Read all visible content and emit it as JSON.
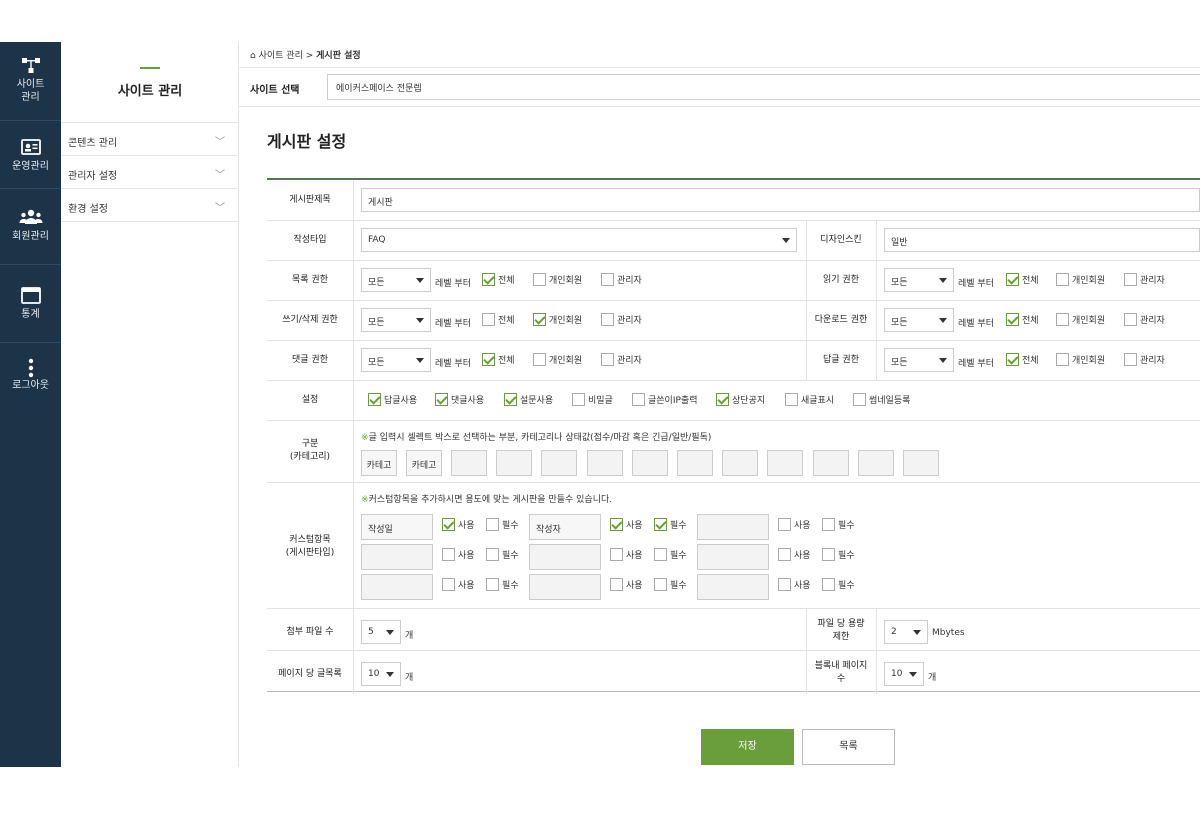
{
  "rail": [
    {
      "icon": "sitemap-icon",
      "label": "사이트\n관리"
    },
    {
      "icon": "id-card-icon",
      "label": "운영관리"
    },
    {
      "icon": "users-icon",
      "label": "회원관리"
    },
    {
      "icon": "browser-window-icon",
      "label": "통계"
    },
    {
      "icon": "more-vertical-icon",
      "label": "로그아웃"
    }
  ],
  "submenu": {
    "title": "사이트 관리",
    "items": [
      {
        "label": "콘텐츠 관리"
      },
      {
        "label": "관리자 설정"
      },
      {
        "label": "환경 설정"
      }
    ]
  },
  "breadcrumb": {
    "home": "사이트 관리",
    "sep": ">",
    "current": "게시판 설정"
  },
  "site": {
    "label": "사이트 선택",
    "value": "에이커스페이스 전문렙"
  },
  "page_title": "게시판 설정",
  "form": {
    "title_label": "게시판제목",
    "title_value": "게시판",
    "type_label": "작성타입",
    "type_value": "FAQ",
    "skin_label": "디자인스킨",
    "skin_value": "일반",
    "level_option": "모든",
    "level_from": "레벨 부터",
    "opt_all": "전체",
    "opt_member": "개인회원",
    "opt_admin": "관리자",
    "list_label": "목록 권한",
    "read_label": "읽기 권한",
    "write_label": "쓰기/삭제 권한",
    "download_label": "다운로드 권한",
    "comment_label": "댓글 권한",
    "reply_label": "답글 권한",
    "settings_label": "설정",
    "settings": [
      {
        "label": "답글사용",
        "on": true
      },
      {
        "label": "댓글사용",
        "on": true
      },
      {
        "label": "설문사용",
        "on": true
      },
      {
        "label": "비밀글",
        "on": false
      },
      {
        "label": "글쓴이IP출력",
        "on": false
      },
      {
        "label": "상단공지",
        "on": true
      },
      {
        "label": "새글표시",
        "on": false
      },
      {
        "label": "썸네일등록",
        "on": false
      }
    ],
    "category_label": "구분\n(카테고리)",
    "category_note_mark": "※",
    "category_note": "글 입력시 셀렉트 박스로 선택하는 부분, 카테고리나 상태값(접수/마감 혹은 긴급/일반/필독)",
    "category_filled": [
      "카테고",
      "카테고"
    ],
    "custom_label": "커스텀항목\n(게시판타입)",
    "custom_note_mark": "※",
    "custom_note": "커스텀항목을 추가하시면 용도에 맞는 게시판을 만들수 있습니다.",
    "custom_use": "사용",
    "custom_req": "필수",
    "custom_fields": [
      "작성일",
      "작성자"
    ],
    "attach_label": "첨부 파일 수",
    "attach_value": "5",
    "attach_unit": "개",
    "filesize_label": "파일 당 용량\n제한",
    "filesize_value": "2",
    "filesize_unit": "Mbytes",
    "perpage_label": "페이지 당 글목록",
    "perpage_value": "10",
    "perpage_unit": "개",
    "block_label": "블록내 페이지\n수",
    "block_value": "10",
    "block_unit": "개"
  },
  "buttons": {
    "save": "저장",
    "list": "목록"
  },
  "colors": {
    "rail": "#1d3348",
    "accent": "#6a9e3a",
    "header_line": "#4f7c4c"
  }
}
